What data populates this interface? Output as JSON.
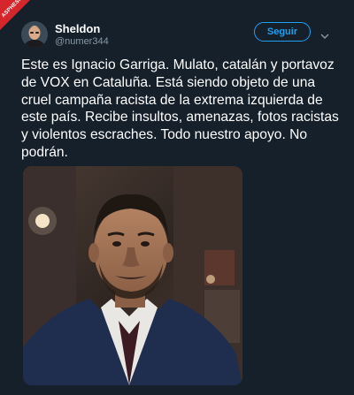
{
  "tweet": {
    "author_name": "Sheldon",
    "author_handle": "@numer344",
    "follow_label": "Seguir",
    "text": "Este es Ignacio Garriga. Mulato, catalán y portavoz de VOX en Cataluña. Está siendo objeto de una cruel campaña racista de la extrema izquierda de este país. Recibe insultos, amenazas, fotos racistas y violentos escraches. Todo nuestro apoyo. No podrán."
  },
  "watermark": {
    "text": "ASPHESPAÑA.COM"
  },
  "icons": {
    "menu": "chevron-down-icon",
    "photo": "portrait-photo"
  },
  "colors": {
    "background": "#15202b",
    "accent": "#1da1f2",
    "secondary_text": "#8899a6"
  }
}
